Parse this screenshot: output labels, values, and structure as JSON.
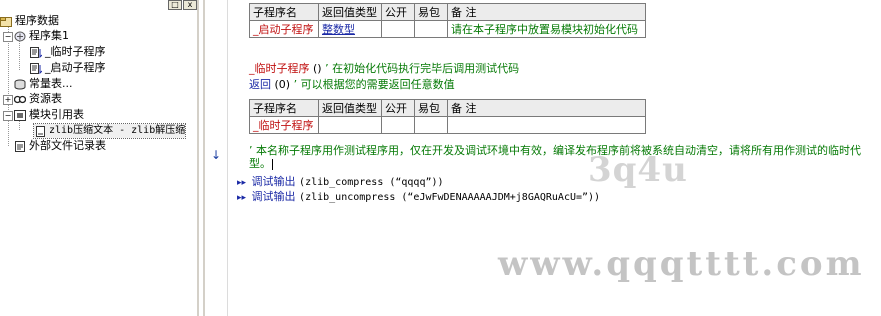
{
  "tree": {
    "root": "程序数据",
    "program_set": "程序集1",
    "sub_temp": "_临时子程序",
    "sub_start": "_启动子程序",
    "constants": "常量表...",
    "resources": "资源表",
    "module_ref": "模块引用表",
    "module_item": "zlib压缩文本 - zlib解压缩",
    "external_files": "外部文件记录表"
  },
  "table1": {
    "headers": [
      "子程序名",
      "返回值类型",
      "公开",
      "易包",
      "备 注"
    ],
    "row": [
      "_启动子程序",
      "整数型",
      "",
      "",
      "请在本子程序中放置易模块初始化代码"
    ]
  },
  "code": {
    "line1_name": "_临时子程序",
    "line1_args": "()",
    "line1_comment": "’ 在初始化代码执行完毕后调用测试代码",
    "line2_keyword": "返回",
    "line2_args": "(0)",
    "line2_comment": "’ 可以根据您的需要返回任意数值"
  },
  "table2": {
    "headers": [
      "子程序名",
      "返回值类型",
      "公开",
      "易包",
      "备 注"
    ],
    "row": [
      "_临时子程序",
      "",
      "",
      "",
      ""
    ]
  },
  "comment_block": {
    "line1": "’ 本名称子程序用作测试程序用，仅在开发及调试环境中有效，编译发布程序前将被系统自动清空，请将所有用作测试的临时代",
    "line2": "型。"
  },
  "debug_lines": [
    {
      "cmd": "调试输出",
      "text": "(zlib_compress (“qqqq”))"
    },
    {
      "cmd": "调试输出",
      "text": "(zlib_uncompress (“eJwFwDENAAAAAJDM+j8GAQRuAcU=”))"
    }
  ],
  "gutter": {
    "arrow": "↓"
  },
  "window_buttons": [
    "□",
    "x"
  ],
  "watermarks": {
    "big": "3q4u",
    "small": "www.qqqtttt.com"
  }
}
